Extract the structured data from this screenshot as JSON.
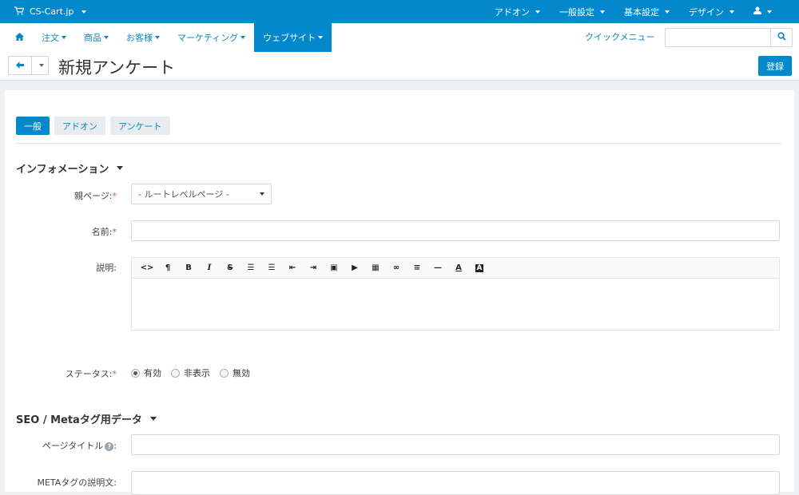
{
  "topbar": {
    "brand": "CS-Cart.jp",
    "menu": [
      "アドオン",
      "一般設定",
      "基本設定",
      "デザイン"
    ]
  },
  "subnav": {
    "items": [
      "注文",
      "商品",
      "お客様",
      "マーケティング",
      "ウェブサイト"
    ],
    "active": "ウェブサイト",
    "quick_menu": "クイックメニュー",
    "search_placeholder": ""
  },
  "header": {
    "title": "新規アンケート",
    "save_label": "登録"
  },
  "tabs": [
    "一般",
    "アドオン",
    "アンケート"
  ],
  "sections": {
    "info": "インフォメーション",
    "seo": "SEO / Metaタグ用データ"
  },
  "form": {
    "parent_label": "親ページ:",
    "parent_value": "- ルートレベルページ -",
    "name_label": "名前:",
    "desc_label": "説明:",
    "status_label": "ステータス:",
    "status_options": [
      "有効",
      "非表示",
      "無効"
    ],
    "status_selected": "有効",
    "page_title_label": "ページタイトル",
    "meta_desc_label": "METAタグの説明文:"
  },
  "toolbar_icons": [
    "code-icon",
    "paragraph-icon",
    "bold-icon",
    "italic-icon",
    "strikethrough-icon",
    "unordered-list-icon",
    "ordered-list-icon",
    "outdent-icon",
    "indent-icon",
    "image-icon",
    "video-icon",
    "table-icon",
    "link-icon",
    "align-icon",
    "horizontal-rule-icon",
    "font-color-icon",
    "background-color-icon"
  ]
}
